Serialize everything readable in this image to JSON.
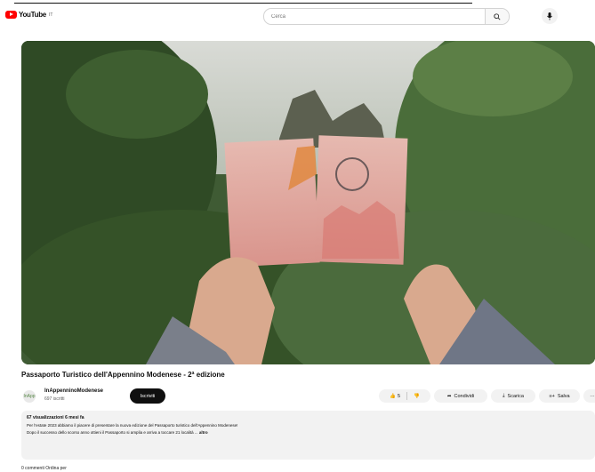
{
  "header": {
    "logo_text": "YouTube",
    "logo_sup": "IT",
    "search_placeholder": "Cerca",
    "colors": {
      "brand": "#ff0000"
    }
  },
  "video": {
    "title": "Passaporto Turistico dell'Appennino Modenese - 2ª edizione"
  },
  "channel": {
    "name": "InAppenninoModenese",
    "subscribers": "697 iscritti",
    "avatar_text": "InApp",
    "subscribe_label": "Iscriviti"
  },
  "actions": {
    "likes": "5",
    "share_label": "Condividi",
    "download_label": "Scarica",
    "save_label": "Salva",
    "more_label": "···"
  },
  "description": {
    "stats": "67 visualizzazioni  6 mesi fa",
    "line1": "Per l'estate 2023 abbiamo il piacere di presentare la nuova edizione del Passaporto turistico dell'Appennino Modenese!",
    "line2": "Dopo il successo dello scorso anno ottieni il Passaporto si amplia e arriva a toccare 21 località ...",
    "more_label": "altro"
  },
  "comments": {
    "hint": "0 commenti  Ordina per"
  },
  "icons": {
    "search": "search-icon",
    "mic": "mic-icon",
    "like": "thumbs-up-icon",
    "dislike": "thumbs-down-icon",
    "share": "share-icon",
    "download": "download-icon",
    "save": "save-icon"
  }
}
